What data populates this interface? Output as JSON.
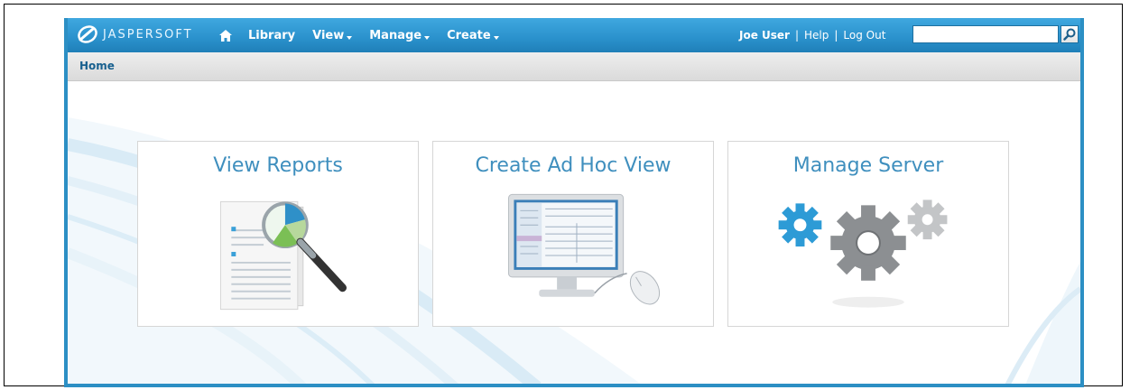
{
  "header": {
    "logo_text": "JASPERSOFT",
    "nav": {
      "home_icon": "home-icon",
      "library": "Library",
      "view": "View",
      "manage": "Manage",
      "create": "Create"
    },
    "user": {
      "name": "Joe User",
      "help": "Help",
      "logout": "Log Out",
      "separator": "|"
    },
    "search": {
      "value": "",
      "icon": "search-icon"
    }
  },
  "breadcrumb": {
    "home": "Home"
  },
  "tiles": [
    {
      "title": "View Reports",
      "icon": "reports-magnifier-icon"
    },
    {
      "title": "Create Ad Hoc View",
      "icon": "monitor-mouse-icon"
    },
    {
      "title": "Manage Server",
      "icon": "gears-icon"
    }
  ],
  "colors": {
    "brand_blue": "#2c8fc4",
    "tile_title": "#3f8fbe",
    "breadcrumb_text": "#18608f"
  }
}
